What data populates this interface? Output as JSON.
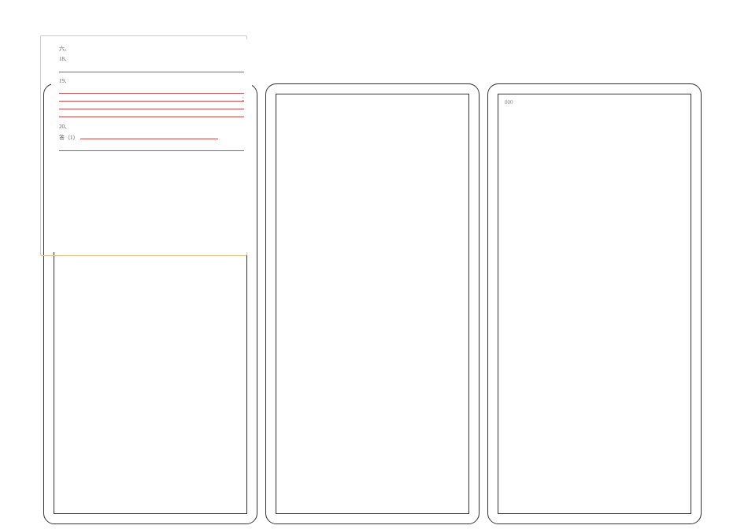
{
  "overlay": {
    "section_heading": "六、",
    "q18_label": "18、",
    "q19_label": "19、",
    "q20_label": "20、",
    "q20_answer_prefix": "答（1）"
  },
  "page3": {
    "mark": "800"
  }
}
